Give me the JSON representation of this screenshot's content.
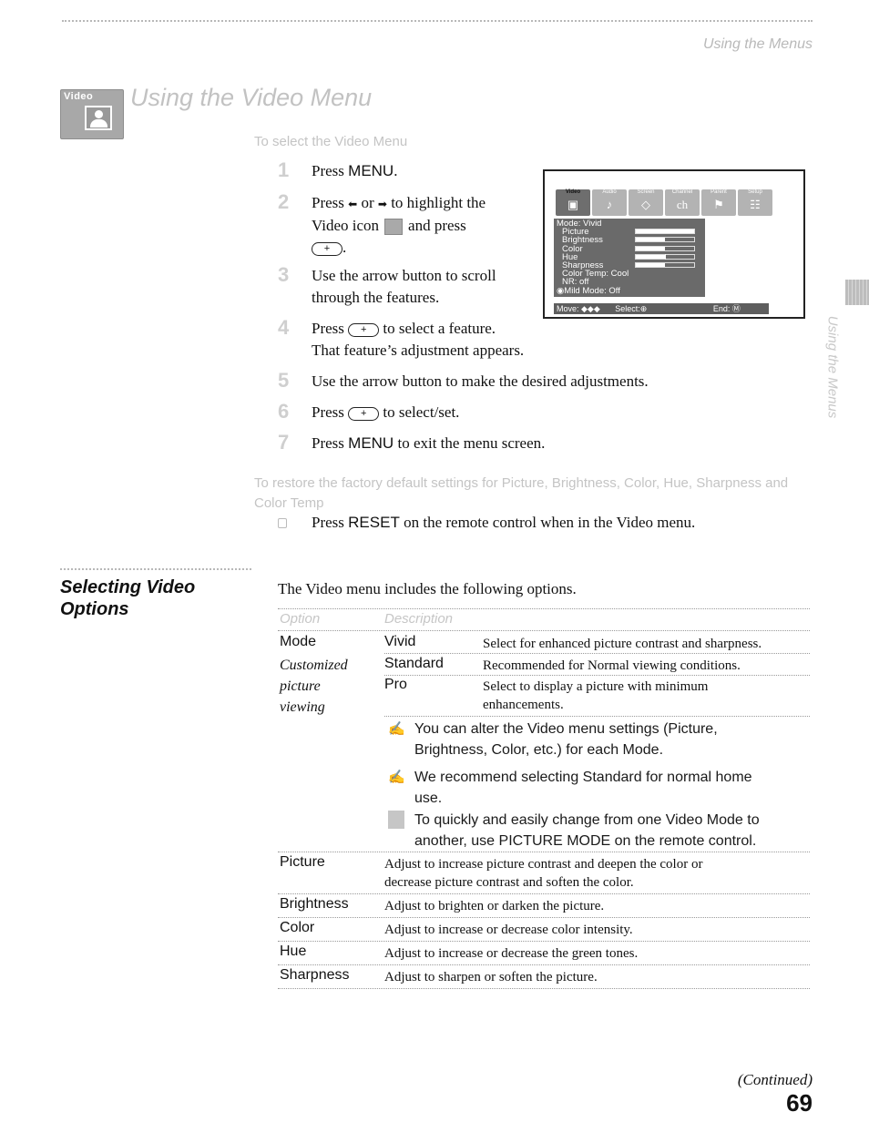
{
  "header": {
    "running_head": "Using the Menus",
    "badge_label": "Video",
    "title": "Using the Video Menu",
    "side_label": "Using the Menus"
  },
  "select_section": {
    "heading": "To select the Video Menu",
    "steps": [
      {
        "num": "1",
        "parts": [
          "Press ",
          "MENU",
          "."
        ]
      },
      {
        "num": "2",
        "line1_a": "Press ",
        "arrow_left": "⬅",
        "line1_b": " or ",
        "arrow_right": "➡",
        "line1_c": " to highlight the",
        "line2_a": "Video icon",
        "line2_b": "and press",
        "line3": "."
      },
      {
        "num": "3",
        "line1": "Use the arrow button to scroll",
        "line2": "through the features."
      },
      {
        "num": "4",
        "line1_a": "Press ",
        "line1_b": " to select a feature.",
        "line2": "That feature’s adjustment appears."
      },
      {
        "num": "5",
        "line1": "Use the arrow button to make the desired adjustments."
      },
      {
        "num": "6",
        "line1_a": "Press ",
        "line1_b": " to select/set."
      },
      {
        "num": "7",
        "parts": [
          "Press ",
          "MENU",
          " to exit the menu screen."
        ]
      }
    ],
    "plus_button_glyph": "+"
  },
  "osd": {
    "tabs": [
      {
        "label": "Video",
        "glyph": "▣",
        "active": true
      },
      {
        "label": "Audio",
        "glyph": "♪",
        "active": false
      },
      {
        "label": "Screen",
        "glyph": "◇",
        "active": false
      },
      {
        "label": "Channel",
        "glyph": "ch",
        "active": false
      },
      {
        "label": "Parent",
        "glyph": "⚑",
        "active": false
      },
      {
        "label": "Setup",
        "glyph": "☷",
        "active": false
      }
    ],
    "mode_line": "Mode: Vivid",
    "settings": [
      {
        "label": "Picture",
        "level": 1.0
      },
      {
        "label": "Brightness",
        "level": 0.5
      },
      {
        "label": "Color",
        "level": 0.5
      },
      {
        "label": "Hue",
        "level": 0.5,
        "center_tick": true
      },
      {
        "label": "Sharpness",
        "level": 0.5
      }
    ],
    "color_temp": "Color Temp: Cool",
    "nr": "NR: off",
    "mild_mode": "◉Mild Mode: Off",
    "footer": {
      "move": "Move: ◆◆◆",
      "select": "Select:⊕",
      "end": "End: Ⓜ"
    }
  },
  "restore_section": {
    "heading": "To restore the factory default settings for Picture, Brightness, Color, Hue, Sharpness and Color Temp",
    "step_a": "Press ",
    "step_key": "RESET",
    "step_b": " on the remote control when in the Video menu."
  },
  "options_section": {
    "title_line1": "Selecting Video",
    "title_line2": "Options",
    "intro": "The Video menu includes the following options.",
    "table": {
      "headers": [
        "Option",
        "Description"
      ],
      "mode": {
        "label": "Mode",
        "sublabel": [
          "Customized",
          "picture",
          "viewing"
        ],
        "choices": [
          {
            "name": "Vivid",
            "desc": [
              "Select for enhanced picture contrast and sharpness."
            ]
          },
          {
            "name": "Standard",
            "desc": [
              "Recommended for Normal viewing conditions."
            ]
          },
          {
            "name": "Pro",
            "desc": [
              "Select to display a picture with minimum",
              "enhancements."
            ]
          }
        ],
        "notes": [
          {
            "icon": "✍",
            "lines": [
              "You can alter the Video menu settings (Picture,",
              "Brightness, Color, etc.) for each Mode."
            ]
          },
          {
            "icon": "✍",
            "lines": [
              "We recommend selecting Standard for normal home",
              "use."
            ]
          }
        ],
        "tip": [
          "To quickly and easily change from one Video Mode to",
          "another, use PICTURE MODE on the remote control."
        ]
      },
      "rows": [
        {
          "option": "Picture",
          "desc": [
            "Adjust to increase picture contrast and deepen the color or",
            "decrease picture contrast and soften the color."
          ]
        },
        {
          "option": "Brightness",
          "desc": [
            "Adjust to brighten or darken the picture."
          ]
        },
        {
          "option": "Color",
          "desc": [
            "Adjust to increase or decrease color intensity."
          ]
        },
        {
          "option": "Hue",
          "desc": [
            "Adjust to increase or decrease the green tones."
          ]
        },
        {
          "option": "Sharpness",
          "desc": [
            "Adjust to sharpen or soften the picture."
          ]
        }
      ]
    }
  },
  "footer": {
    "continued": "(Continued)",
    "page_number": "69"
  }
}
